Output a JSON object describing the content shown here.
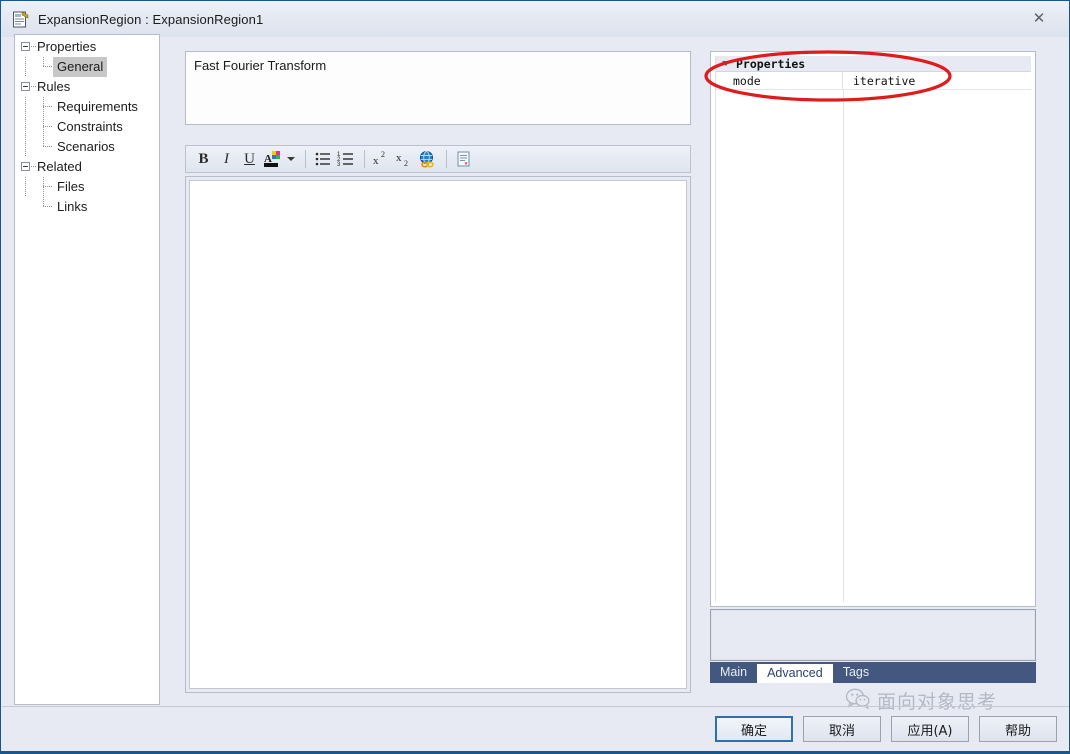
{
  "window": {
    "title": "ExpansionRegion : ExpansionRegion1",
    "icon": "app-icon",
    "close_label": "✕"
  },
  "tree": {
    "nodes": [
      {
        "label": "Properties",
        "level": 0,
        "expanded": true,
        "selected": false
      },
      {
        "label": "General",
        "level": 1,
        "expanded": false,
        "selected": true
      },
      {
        "label": "Rules",
        "level": 0,
        "expanded": true,
        "selected": false
      },
      {
        "label": "Requirements",
        "level": 1,
        "expanded": false,
        "selected": false
      },
      {
        "label": "Constraints",
        "level": 1,
        "expanded": false,
        "selected": false
      },
      {
        "label": "Scenarios",
        "level": 1,
        "expanded": false,
        "selected": false
      },
      {
        "label": "Related",
        "level": 0,
        "expanded": true,
        "selected": false
      },
      {
        "label": "Files",
        "level": 1,
        "expanded": false,
        "selected": false
      },
      {
        "label": "Links",
        "level": 1,
        "expanded": false,
        "selected": false
      }
    ]
  },
  "name_field": {
    "value": "Fast Fourier Transform",
    "placeholder": ""
  },
  "toolbar": {
    "buttons": [
      {
        "name": "bold-icon",
        "glyph": "B"
      },
      {
        "name": "italic-icon",
        "glyph": "I"
      },
      {
        "name": "underline-icon",
        "glyph": "U"
      },
      {
        "name": "font-color-icon",
        "glyph": "A"
      },
      {
        "name": "font-color-dropdown",
        "glyph": ""
      },
      {
        "name": "bullet-list-icon",
        "glyph": ""
      },
      {
        "name": "numbered-list-icon",
        "glyph": ""
      },
      {
        "name": "superscript-icon",
        "glyph": "x"
      },
      {
        "name": "subscript-icon",
        "glyph": "x"
      },
      {
        "name": "hyperlink-icon",
        "glyph": ""
      },
      {
        "name": "document-icon",
        "glyph": ""
      }
    ]
  },
  "editor": {
    "content": ""
  },
  "grid": {
    "group_label": "Properties",
    "rows": [
      {
        "name": "mode",
        "value": "iterative"
      }
    ]
  },
  "description_box": {
    "text": ""
  },
  "tabs": [
    {
      "label": "Main",
      "active": false
    },
    {
      "label": "Advanced",
      "active": true
    },
    {
      "label": "Tags",
      "active": false
    }
  ],
  "buttons": {
    "ok": "确定",
    "cancel": "取消",
    "apply": "应用(A)",
    "help": "帮助"
  },
  "annotation": {
    "shape": "ellipse",
    "color": "#e01b1b",
    "targets": "properties-grid-mode-row"
  },
  "watermark": {
    "text": "面向对象思考",
    "icon": "wechat-icon"
  },
  "colors": {
    "dialog_bg": "#e7eaf3",
    "border": "#17578f",
    "tab_bar": "#44587f",
    "accent": "#2f6fae",
    "annotation_red": "#e01b1b"
  }
}
